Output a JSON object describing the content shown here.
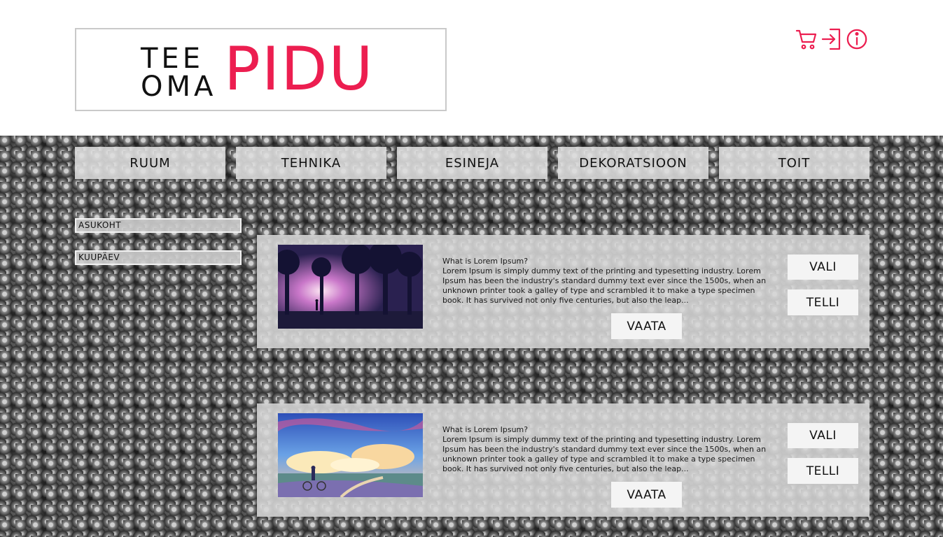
{
  "logo": {
    "line1": "TEE",
    "line2": "OMA",
    "big": "PIDU",
    "brand_color": "#ec1e50"
  },
  "header_icons": [
    {
      "icon": "cart-icon"
    },
    {
      "icon": "login-icon"
    },
    {
      "icon": "info-icon"
    }
  ],
  "nav": {
    "items": [
      {
        "label": "RUUM"
      },
      {
        "label": "TEHNIKA"
      },
      {
        "label": "ESINEJA"
      },
      {
        "label": "DEKORATSIOON"
      },
      {
        "label": "TOIT"
      }
    ]
  },
  "filters": {
    "location_label": "ASUKOHT",
    "date_label": "KUUPÄEV"
  },
  "cards": [
    {
      "image": "forest-night-scene",
      "question": "What is Lorem Ipsum?",
      "text": "Lorem Ipsum is simply dummy text of the printing and typesetting industry. Lorem Ipsum has been the industry's standard dummy text ever since the 1500s, when an unknown printer took a galley of type and scrambled it to make a type specimen book. It has survived not only five centuries, but also the leap...",
      "vali_label": "VALI",
      "telli_label": "TELLI",
      "vaata_label": "VAATA"
    },
    {
      "image": "sky-clouds-bicycle-scene",
      "question": "What is Lorem Ipsum?",
      "text": "Lorem Ipsum is simply dummy text of the printing and typesetting industry. Lorem Ipsum has been the industry's standard dummy text ever since the 1500s, when an unknown printer took a galley of type and scrambled it to make a type specimen book. It has survived not only five centuries, but also the leap...",
      "vali_label": "VALI",
      "telli_label": "TELLI",
      "vaata_label": "VAATA"
    }
  ]
}
